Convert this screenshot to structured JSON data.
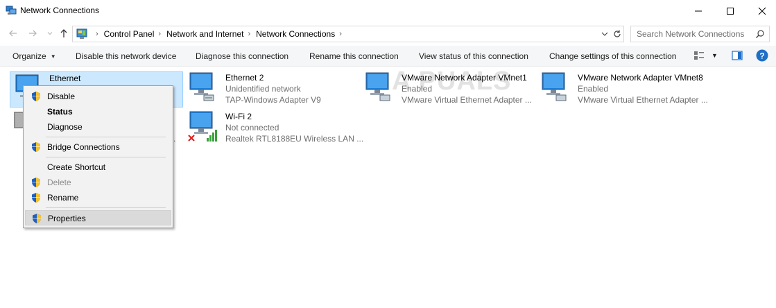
{
  "window": {
    "title": "Network Connections",
    "icons": {
      "app": "network-connections-icon",
      "minimize": "minimize-icon",
      "maximize": "maximize-icon",
      "close": "close-icon"
    }
  },
  "nav": {
    "breadcrumbs": [
      "Control Panel",
      "Network and Internet",
      "Network Connections"
    ],
    "search_placeholder": "Search Network Connections"
  },
  "toolbar": {
    "organize": "Organize",
    "disable": "Disable this network device",
    "diagnose": "Diagnose this connection",
    "rename": "Rename this connection",
    "view_status": "View status of this connection",
    "change_settings": "Change settings of this connection"
  },
  "connections": [
    {
      "name": "Ethernet",
      "status": "",
      "adapter": "",
      "selected": true
    },
    {
      "name": "Ethernet 2",
      "status": "Unidentified network",
      "adapter": "TAP-Windows Adapter V9"
    },
    {
      "name": "VMware Network Adapter VMnet1",
      "status": "Enabled",
      "adapter": "VMware Virtual Ethernet Adapter ..."
    },
    {
      "name": "VMware Network Adapter VMnet8",
      "status": "Enabled",
      "adapter": "VMware Virtual Ethernet Adapter ..."
    },
    {
      "name": "Wi-Fi 2",
      "status": "Not connected",
      "adapter": "Realtek RTL8188EU Wireless LAN ..."
    }
  ],
  "hidden_partial": ".",
  "context_menu": {
    "items": [
      {
        "label": "Disable",
        "shield": true
      },
      {
        "label": "Status",
        "bold": true
      },
      {
        "label": "Diagnose"
      },
      {
        "label": "Bridge Connections",
        "shield": true
      },
      {
        "label": "Create Shortcut"
      },
      {
        "label": "Delete",
        "shield": true,
        "disabled": true
      },
      {
        "label": "Rename",
        "shield": true
      },
      {
        "label": "Properties",
        "shield": true,
        "highlighted": true
      }
    ]
  },
  "watermark": "A PUALS",
  "colors": {
    "selection_bg": "#cce8ff",
    "selection_border": "#99d1ff",
    "toolbar_bg": "#f5f6f7",
    "monitor_blue": "#1e7fd8"
  }
}
